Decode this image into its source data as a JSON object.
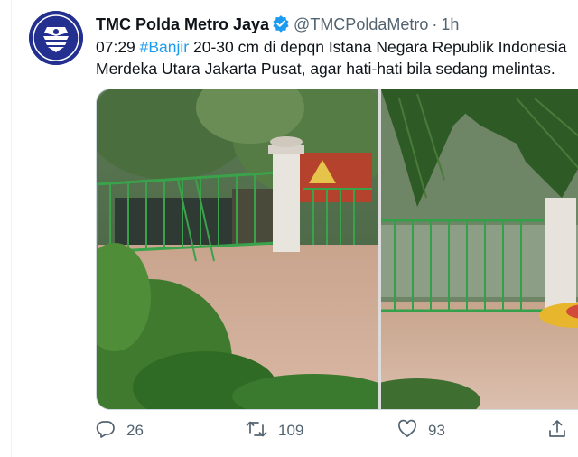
{
  "tweet": {
    "display_name": "TMC Polda Metro Jaya",
    "handle": "@TMCPoldaMetro",
    "separator": "·",
    "time": "1h",
    "text_line1_prefix": "07:29 ",
    "hashtag": "#Banjir",
    "text_line1_rest": " 20-30 cm di depqn Istana Negara Republik Indonesia",
    "text_line2": "Merdeka Utara Jakarta Pusat, agar hati-hati bila sedang melintas.",
    "verified_icon": "verified-badge-icon"
  },
  "actions": {
    "reply_count": "26",
    "retweet_count": "109",
    "like_count": "93"
  },
  "icons": {
    "reply": "reply-icon",
    "retweet": "retweet-icon",
    "like": "heart-icon",
    "share": "share-icon"
  },
  "colors": {
    "accent": "#1d9bf0",
    "muted": "#536471",
    "avatar_bg": "#1f2d8c"
  }
}
